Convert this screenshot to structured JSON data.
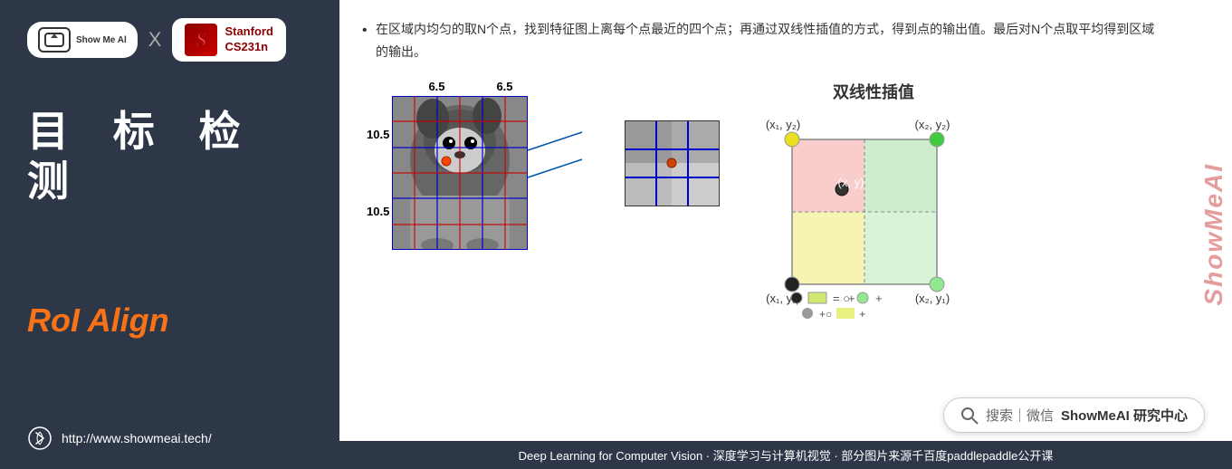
{
  "sidebar": {
    "logo": {
      "showmeai_label": "Show Me Al",
      "x_label": "X",
      "stanford_label": "Stanford\nCS231n"
    },
    "main_title": "目 标 检 测",
    "section_label": "RoI Align",
    "footer_url": "http://www.showmeai.tech/"
  },
  "content": {
    "bullet_text": "在区域内均匀的取N个点，找到特征图上离每个点最近的四个点；再通过双线性插值的方式，得到点的输出值。最后对N个点取平均得到区域的输出。",
    "diagram": {
      "top_nums": [
        "6.5",
        "6.5"
      ],
      "side_nums": [
        "10.5",
        "10.5"
      ]
    },
    "bilinear": {
      "title": "双线性插值",
      "labels": {
        "top_left": "(x₁, y₂)",
        "top_right": "(x₂, y₂)",
        "center": "(x, y)",
        "bottom_left": "(x₁, y₁)",
        "bottom_right": "(x₂, y₁)"
      }
    },
    "search_bar": {
      "icon": "search",
      "text": "搜索｜微信",
      "brand": "ShowMeAI 研究中心"
    },
    "footer": {
      "text": "Deep Learning for Computer Vision · 深度学习与计算机视觉 · 部分图片来源千百度paddlepaddle公开课"
    },
    "watermark": "ShowMeAI"
  }
}
